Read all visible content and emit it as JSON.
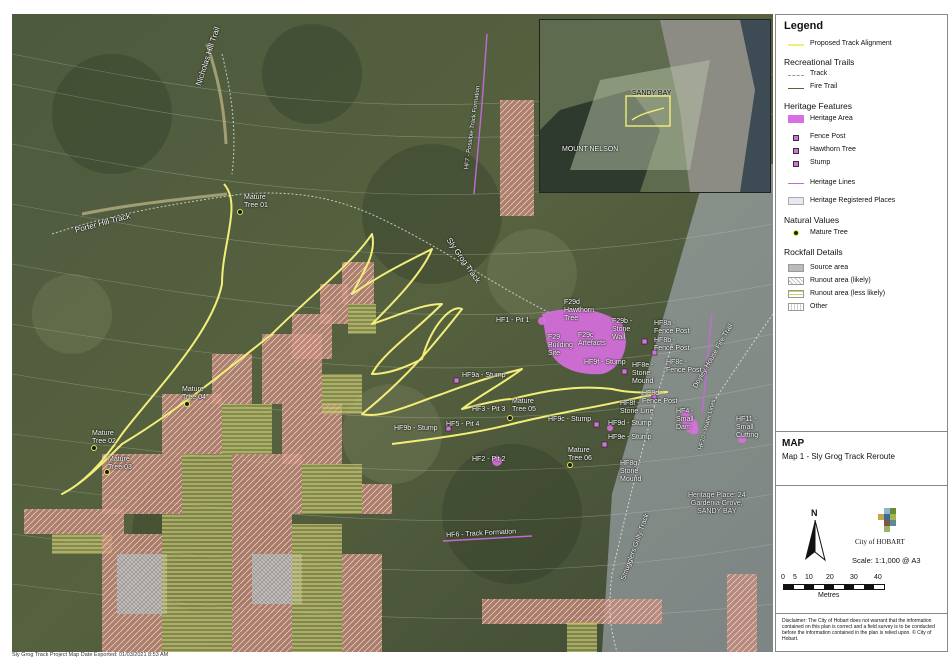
{
  "legend": {
    "title": "Legend",
    "proposed": "Proposed Track Alignment",
    "recreational_title": "Recreational Trails",
    "track": "Track",
    "fire_trail": "Fire Trail",
    "heritage_title": "Heritage Features",
    "heritage_area": "Heritage Area",
    "fence_post": "Fence Post",
    "hawthorn_tree": "Hawthorn Tree",
    "stump": "Stump",
    "heritage_lines": "Heritage Lines",
    "heritage_registered": "Heritage Registered Places",
    "natural_title": "Natural Values",
    "mature_tree": "Mature Tree",
    "rockfall_title": "Rockfall Details",
    "source_area": "Source area",
    "runout_likely": "Runout area (likely)",
    "runout_less": "Runout area (less likely)",
    "other": "Other"
  },
  "map_box": {
    "heading": "MAP",
    "subtitle": "Map 1 - Sly Grog Track Reroute"
  },
  "north": "N",
  "logo_text": "City of HOBART",
  "scale_text": "Scale: 1:1,000 @ A3",
  "scale_ticks": [
    "0",
    "5",
    "10",
    "20",
    "30",
    "40"
  ],
  "scale_unit": "Metres",
  "disclaimer": "Disclaimer: The City of Hobart does not warrant that the information contained on this plan is correct and a field survey is to be conducted before the information contained in the plan is relied upon. © City of Hobart.",
  "footer": "Sly Grog Track Project Map Date Exported: 01/03/2021 8:53 AM",
  "inset": {
    "sandy_bay": "SANDY BAY",
    "mount_nelson": "MOUNT NELSON"
  },
  "roads": {
    "nicholas": "Nicholas Hill Trail",
    "porter": "Porter Hill Track",
    "sly_grog": "Sly Grog Track",
    "hf7": "HF7 - Possible Track Formation",
    "doyley": "Doyley House Fire Trail",
    "smugglers": "Smugglers Gully Track",
    "hf6": "HF6 - Track Formation",
    "hf10": "HF10 - Water Lines"
  },
  "labels": {
    "mt01": "Mature\nTree 01",
    "mt04": "Mature\nTree 04",
    "mt02": "Mature\nTree 02",
    "mt03": "Mature\nTree 03",
    "mt05": "Mature\nTree 05",
    "mt06": "Mature\nTree 06",
    "hf1": "HF1 - Pit 1",
    "hf29d": "F29d\nHawthorn\nTree",
    "hf29b": "F29b -\nStone\nWall",
    "hf29c": "F29c\nArtefacts",
    "hf29": "F29\nBuilding\nSite",
    "hf8a": "HF8a -\nFence Post",
    "hf8b": "HF8b -\nFence Post",
    "hf8c": "HF8c -\nFence Post",
    "hf9f": "HF9f - Stump",
    "hf8e": "HF8e -\nStone\nMound",
    "hf8d": "HF8d -\nFence Post",
    "hf9a": "HF9a - Stump",
    "hf3": "HF3 - Pit 3",
    "hf9b": "HF9b - Stump",
    "hf5": "HF5 - Pit 4",
    "hf9c": "HF9c - Stump",
    "hf9d": "HF9d - Stump",
    "hf8f": "HF8f -\nStone Line",
    "hf9e": "HF9e - Stump",
    "hf4": "HF4 -\nSmall\nDam",
    "hf11": "HF11 -\nSmall\nCutting",
    "hf2": "HF2 - Pit 2",
    "hf8g": "HF8g -\nStone\nMound",
    "heritage_place": "Heritage Place: 24\nGardenia Grove,\nSANDY BAY"
  },
  "colors": {
    "track": "#f3ee7a",
    "heritage": "#d86fe0",
    "runout": "#c98a7a",
    "runout_less": "#c9d36a"
  }
}
